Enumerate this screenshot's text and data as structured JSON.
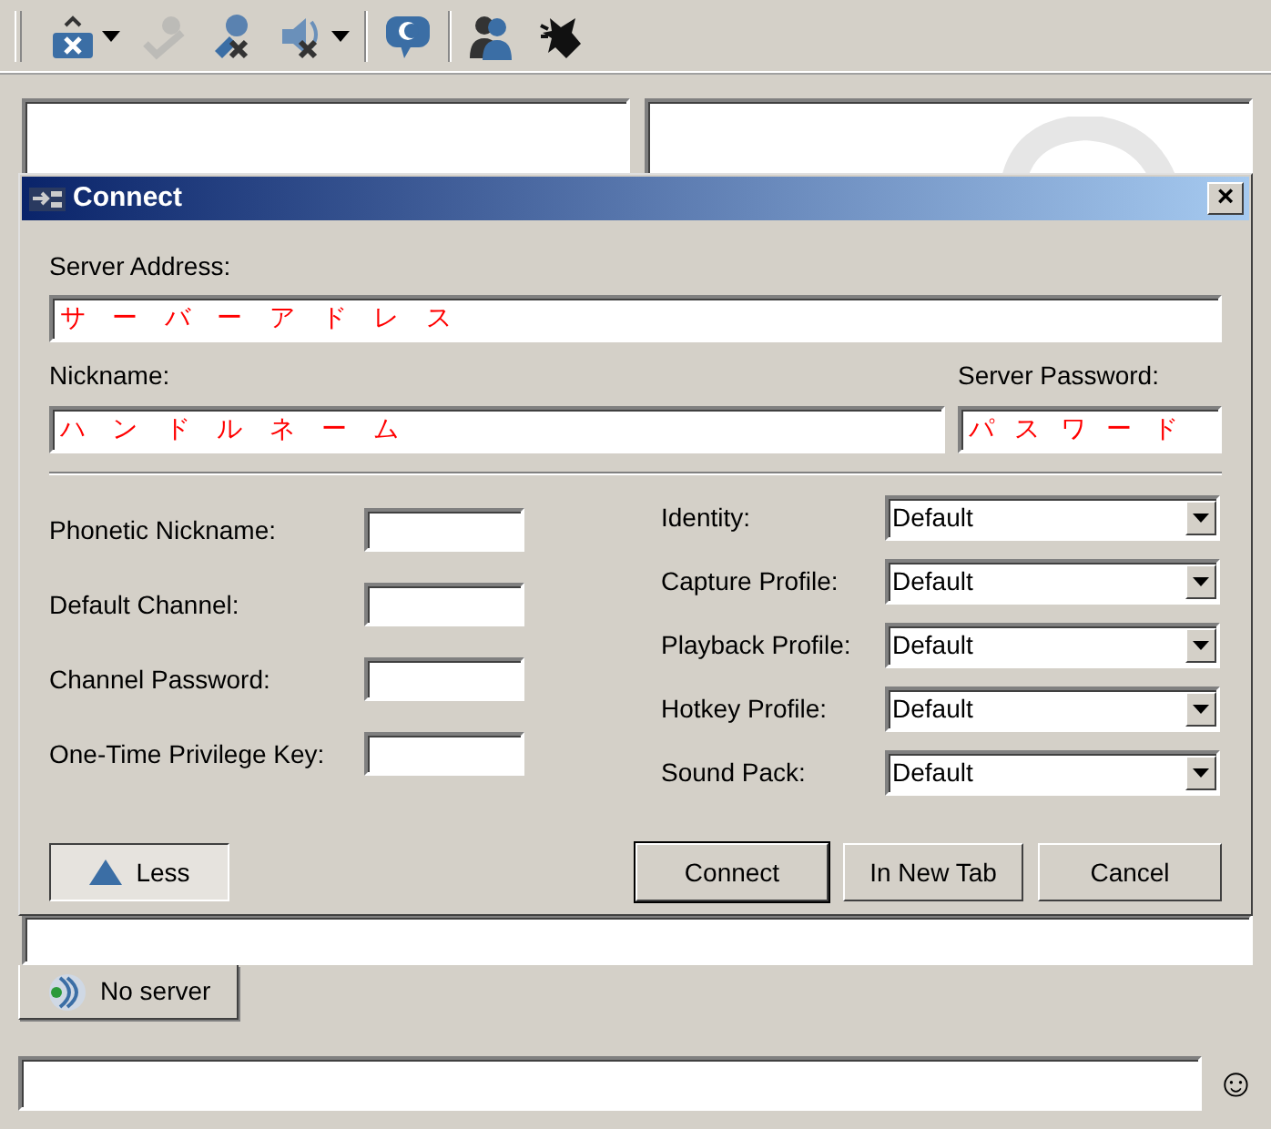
{
  "toolbar": [
    {
      "kind": "tray-x",
      "menu": true,
      "disabled": false
    },
    {
      "kind": "check",
      "menu": false,
      "disabled": true
    },
    {
      "kind": "mic-x",
      "menu": false,
      "disabled": false
    },
    {
      "kind": "speaker-x",
      "menu": true,
      "disabled": false
    },
    {
      "kind": "separator"
    },
    {
      "kind": "bubble",
      "menu": false,
      "disabled": false
    },
    {
      "kind": "separator"
    },
    {
      "kind": "users",
      "menu": false,
      "disabled": false
    },
    {
      "kind": "creature",
      "menu": false,
      "disabled": false
    }
  ],
  "dialog": {
    "title": "Connect",
    "close": "×",
    "server_address": {
      "label": "Server Address:",
      "value": "サーバーアドレス"
    },
    "nickname": {
      "label": "Nickname:",
      "value": "ハンドルネーム"
    },
    "server_password": {
      "label": "Server Password:",
      "value": "パスワード"
    },
    "left_fields": [
      {
        "label": "Phonetic Nickname:"
      },
      {
        "label": "Default Channel:"
      },
      {
        "label": "Channel Password:"
      },
      {
        "label": "One-Time Privilege Key:"
      }
    ],
    "right_fields": [
      {
        "label": "Identity:",
        "value": "Default"
      },
      {
        "label": "Capture Profile:",
        "value": "Default"
      },
      {
        "label": "Playback Profile:",
        "value": "Default"
      },
      {
        "label": "Hotkey Profile:",
        "value": "Default"
      },
      {
        "label": "Sound Pack:",
        "value": "Default"
      }
    ],
    "less_button": {
      "label": "Less",
      "expanded": true
    },
    "buttons": [
      {
        "label": "Connect",
        "default": true
      },
      {
        "label": "In New Tab",
        "default": false
      },
      {
        "label": "Cancel",
        "default": false
      }
    ]
  },
  "tabs": [
    {
      "label": "No server",
      "selected": true
    }
  ],
  "chat_input": {
    "emoji": "☺"
  }
}
